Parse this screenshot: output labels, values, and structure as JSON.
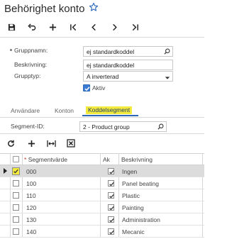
{
  "header": {
    "title": "Behörighet konto"
  },
  "form": {
    "group_name_label": "Gruppnamn:",
    "group_name_value": "ej standardkoddel",
    "description_label": "Beskrivning:",
    "description_value": "ej standardkoddel",
    "group_type_label": "Grupptyp:",
    "group_type_value": "A inverterad",
    "active_label": "Aktiv",
    "active_checked": true
  },
  "tabs": [
    {
      "label": "Användare",
      "active": false
    },
    {
      "label": "Konton",
      "active": false
    },
    {
      "label": "Koddelsegment",
      "active": true
    }
  ],
  "segment": {
    "label": "Segment-ID:",
    "value": "2 - Product group"
  },
  "grid": {
    "columns": {
      "value": "Segmentvärde",
      "active": "Ak",
      "description": "Beskrivning"
    },
    "rows": [
      {
        "value": "000",
        "active": true,
        "description": "Ingen",
        "selected": true
      },
      {
        "value": "100",
        "active": true,
        "description": "Panel beating",
        "selected": false
      },
      {
        "value": "110",
        "active": true,
        "description": "Plastic",
        "selected": false
      },
      {
        "value": "120",
        "active": true,
        "description": "Painting",
        "selected": false
      },
      {
        "value": "130",
        "active": true,
        "description": "Administration",
        "selected": false
      },
      {
        "value": "140",
        "active": true,
        "description": "Mecanic",
        "selected": false
      }
    ]
  },
  "colors": {
    "accent": "#2f6ab8",
    "highlight": "#f4ea3d",
    "selected_row": "#dcdcdc"
  }
}
